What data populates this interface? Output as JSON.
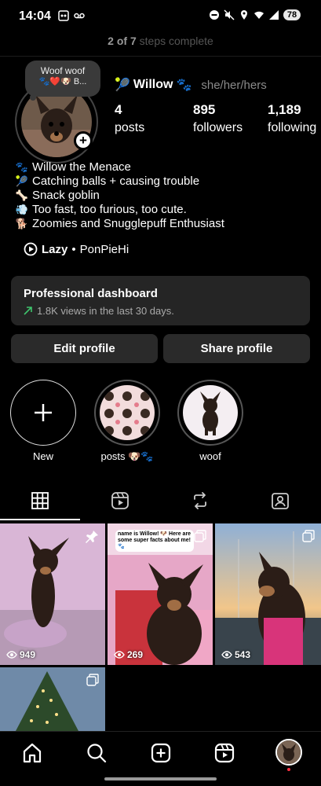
{
  "status_bar": {
    "time": "14:04",
    "battery": "78"
  },
  "steps": {
    "count": "2 of 7",
    "text": " steps complete"
  },
  "note": {
    "text": "Woof woof",
    "emoji": "🐾❤️🐶 B..."
  },
  "profile": {
    "username": "Willow",
    "username_prefix_emoji": "🎾",
    "username_suffix_emoji": "🐾",
    "pronouns": "she/her/hers",
    "stats": [
      {
        "value": "4",
        "label": "posts"
      },
      {
        "value": "895",
        "label": "followers"
      },
      {
        "value": "1,189",
        "label": "following"
      }
    ]
  },
  "bio": [
    {
      "emoji": "🐾",
      "text": "Willow the Menace"
    },
    {
      "emoji": "🎾",
      "text": "Catching balls + causing trouble"
    },
    {
      "emoji": "🦴",
      "text": "Snack goblin"
    },
    {
      "emoji": "💨",
      "text": "Too fast, too furious, too cute."
    },
    {
      "emoji": "🐕",
      "text": "Zoomies and Snugglepuff Enthusiast"
    }
  ],
  "music": {
    "song": "Lazy",
    "separator": " • ",
    "artist": "PonPieHi"
  },
  "dashboard": {
    "title": "Professional dashboard",
    "subtitle": "1.8K views in the last 30 days."
  },
  "buttons": {
    "edit": "Edit profile",
    "share": "Share profile"
  },
  "highlights": [
    {
      "label": "New"
    },
    {
      "label": "posts 🐶🐾"
    },
    {
      "label": "woof"
    }
  ],
  "posts": [
    {
      "views": "949",
      "badge": "pin-icon"
    },
    {
      "views": "269",
      "badge": "carousel-icon",
      "caption": "name is Willow! 🐶 Here are some super facts about me! 🐾"
    },
    {
      "views": "543",
      "badge": "carousel-icon"
    },
    {
      "views": "",
      "badge": "carousel-icon"
    }
  ],
  "colors": {
    "background": "#000000",
    "card": "#252525",
    "button": "#2a2a2a",
    "trend": "#3ec46d",
    "notification": "#ff3040"
  }
}
